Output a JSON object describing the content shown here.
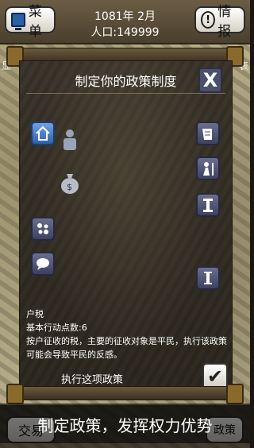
{
  "top": {
    "menu_label": "菜单",
    "info_label": "情报",
    "date": "1081年 2月",
    "population": "人口:149999"
  },
  "background": {
    "left_label": "显",
    "right_label": "表"
  },
  "dialog": {
    "title": "制定你的政策制度",
    "close_glyph": "X",
    "policy": {
      "name": "户税",
      "cost": "基本行动点数:6",
      "description": "按户征收的税，主要的征收对象是平民，执行该政策可能会导致平民的反感。"
    },
    "execute_label": "执行这项政策",
    "check_glyph": "✔"
  },
  "bottom": {
    "trade_label": "交易",
    "right_label": "政策",
    "caption": "制定政策，发挥权力优势"
  },
  "colors": {
    "accent_blue": "#3b6fb8",
    "panel_dark": "#35302a",
    "slate_icon": "#4b4f6a"
  }
}
